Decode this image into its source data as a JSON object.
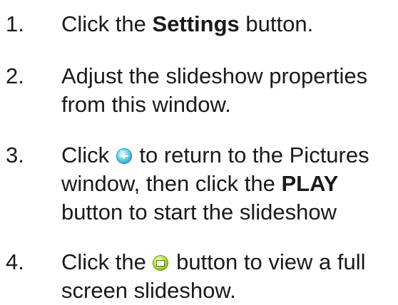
{
  "steps": [
    {
      "number": "1.",
      "lines": [
        {
          "pre": "Click the ",
          "bold": "Settings",
          "post": " button."
        }
      ]
    },
    {
      "number": "2.",
      "lines": [
        {
          "text": "Adjust the slideshow properties"
        },
        {
          "text": "from this window."
        }
      ]
    },
    {
      "number": "3.",
      "lines": [
        {
          "pre": "Click ",
          "icon": "back-arrow-icon",
          "post": " to return to the Pictures"
        },
        {
          "pre": "window, then click the ",
          "bold": "PLAY"
        },
        {
          "text": "button to start the slideshow"
        }
      ]
    },
    {
      "number": "4.",
      "lines": [
        {
          "pre": "Click the ",
          "icon": "fullscreen-icon",
          "post": " button to view a full"
        },
        {
          "text": "screen slideshow."
        }
      ]
    }
  ]
}
